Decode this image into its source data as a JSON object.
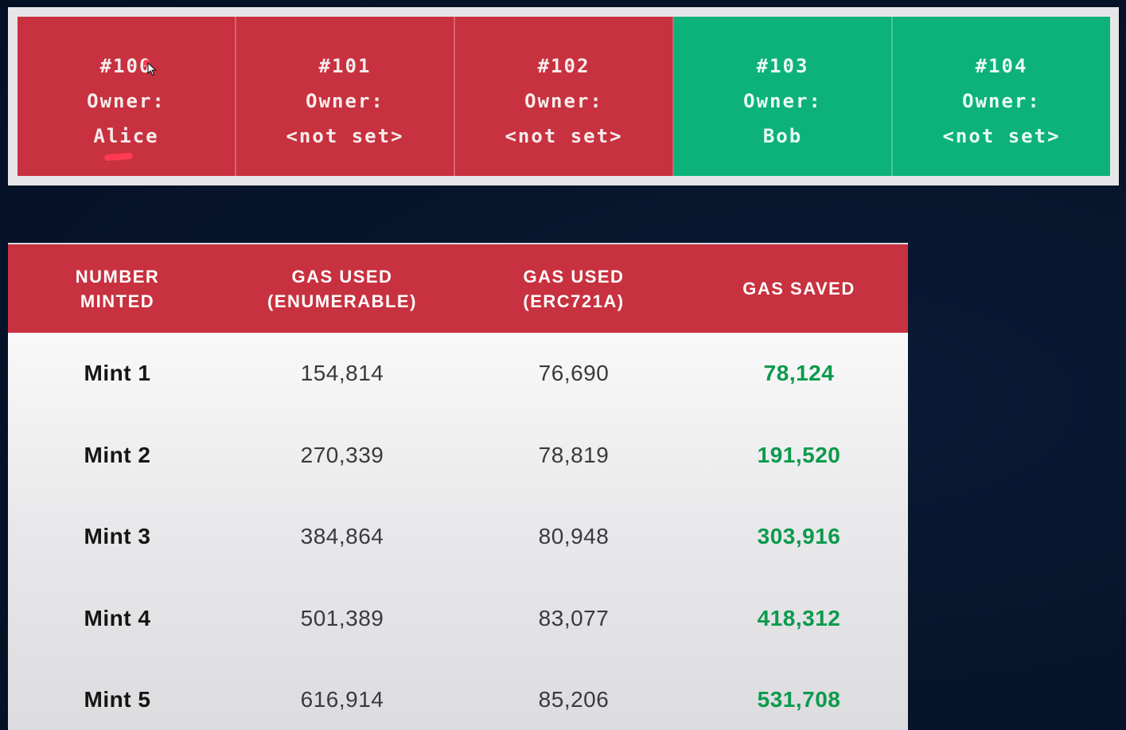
{
  "tokens": [
    {
      "id": "#100",
      "owner_label": "Owner:",
      "owner": "Alice",
      "status": "red"
    },
    {
      "id": "#101",
      "owner_label": "Owner:",
      "owner": "<not set>",
      "status": "red"
    },
    {
      "id": "#102",
      "owner_label": "Owner:",
      "owner": "<not set>",
      "status": "red"
    },
    {
      "id": "#103",
      "owner_label": "Owner:",
      "owner": "Bob",
      "status": "green"
    },
    {
      "id": "#104",
      "owner_label": "Owner:",
      "owner": "<not set>",
      "status": "green"
    }
  ],
  "table": {
    "headers": [
      "NUMBER\nMINTED",
      "GAS USED\n(ENUMERABLE)",
      "GAS USED\n(ERC721A)",
      "GAS SAVED"
    ],
    "rows": [
      [
        "Mint 1",
        "154,814",
        "76,690",
        "78,124"
      ],
      [
        "Mint 2",
        "270,339",
        "78,819",
        "191,520"
      ],
      [
        "Mint 3",
        "384,864",
        "80,948",
        "303,916"
      ],
      [
        "Mint 4",
        "501,389",
        "83,077",
        "418,312"
      ],
      [
        "Mint 5",
        "616,914",
        "85,206",
        "531,708"
      ]
    ]
  },
  "colors": {
    "red": "#c8313f",
    "green": "#0cb27a",
    "saved_text": "#0c9a4c",
    "background": "#07152b"
  },
  "icons": {
    "cursor": "mouse-pointer-icon",
    "annotation": "red-underline-annotation"
  }
}
